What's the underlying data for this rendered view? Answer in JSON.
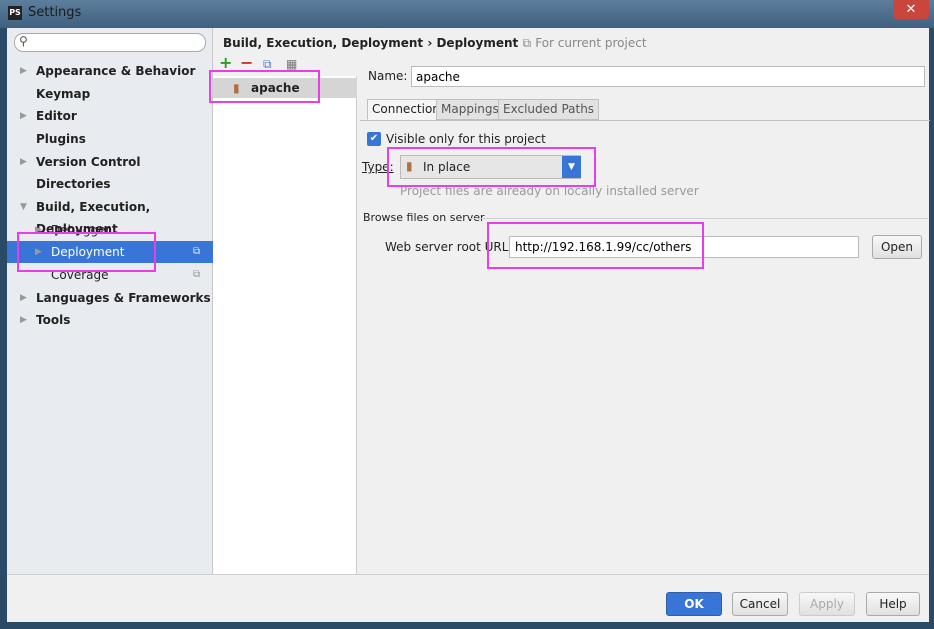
{
  "window": {
    "title": "Settings",
    "app_logo": "PS",
    "close": "✕"
  },
  "sidebar": {
    "search_placeholder": "",
    "items": [
      {
        "label": "Appearance & Behavior",
        "arrow": "▶"
      },
      {
        "label": "Keymap"
      },
      {
        "label": "Editor",
        "arrow": "▶"
      },
      {
        "label": "Plugins"
      },
      {
        "label": "Version Control",
        "arrow": "▶"
      },
      {
        "label": "Directories"
      },
      {
        "label": "Build, Execution, Deployment",
        "arrow": "▼"
      },
      {
        "label": "Debugger",
        "arrow": "▶"
      },
      {
        "label": "Deployment",
        "arrow": "▶",
        "selected": true
      },
      {
        "label": "Coverage"
      },
      {
        "label": "Languages & Frameworks",
        "arrow": "▶"
      },
      {
        "label": "Tools",
        "arrow": "▶"
      }
    ]
  },
  "breadcrumb": {
    "parent": "Build, Execution, Deployment",
    "sep": "›",
    "current": "Deployment",
    "scope": "For current project"
  },
  "servers": {
    "toolbar": {
      "add": "+",
      "remove": "−"
    },
    "items": [
      {
        "label": "apache"
      }
    ]
  },
  "form": {
    "name_label": "Name:",
    "name_value": "apache",
    "tabs": [
      {
        "label": "Connection",
        "active": true
      },
      {
        "label": "Mappings"
      },
      {
        "label": "Excluded Paths"
      }
    ],
    "visible_only_label": "Visible only for this project",
    "visible_only_checked": true,
    "type_label": "Type:",
    "type_value": "In place",
    "type_hint": "Project files are already on locally installed server",
    "browse_section": "Browse files on server",
    "url_label": "Web server root URL:",
    "url_value": "http://192.168.1.99/cc/others",
    "open_label": "Open"
  },
  "footer": {
    "ok": "OK",
    "cancel": "Cancel",
    "apply": "Apply",
    "help": "Help"
  },
  "colors": {
    "accent": "#3875d7",
    "annotation": "#e83de8"
  }
}
